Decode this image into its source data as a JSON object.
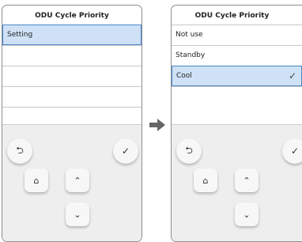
{
  "left_screen": {
    "title": "ODU Cycle Priority",
    "rows": [
      {
        "label": "Setting",
        "selected": true
      },
      {
        "label": ""
      },
      {
        "label": ""
      },
      {
        "label": ""
      },
      {
        "label": ""
      }
    ]
  },
  "right_screen": {
    "title": "ODU Cycle Priority",
    "rows": [
      {
        "label": "Not use"
      },
      {
        "label": "Standby"
      },
      {
        "label": "Cool",
        "selected": true,
        "checked": true
      },
      {
        "label": ""
      }
    ]
  },
  "icons": {
    "back": "back-arrow-icon",
    "confirm": "checkmark-icon",
    "home": "home-icon",
    "up": "chevron-up-icon",
    "down": "chevron-down-icon",
    "transition": "right-arrow-icon"
  },
  "colors": {
    "selection_fill": "#cfe1f6",
    "selection_border": "#4a86c8",
    "pad_background": "#eeeeee",
    "transition_arrow": "#666666"
  }
}
